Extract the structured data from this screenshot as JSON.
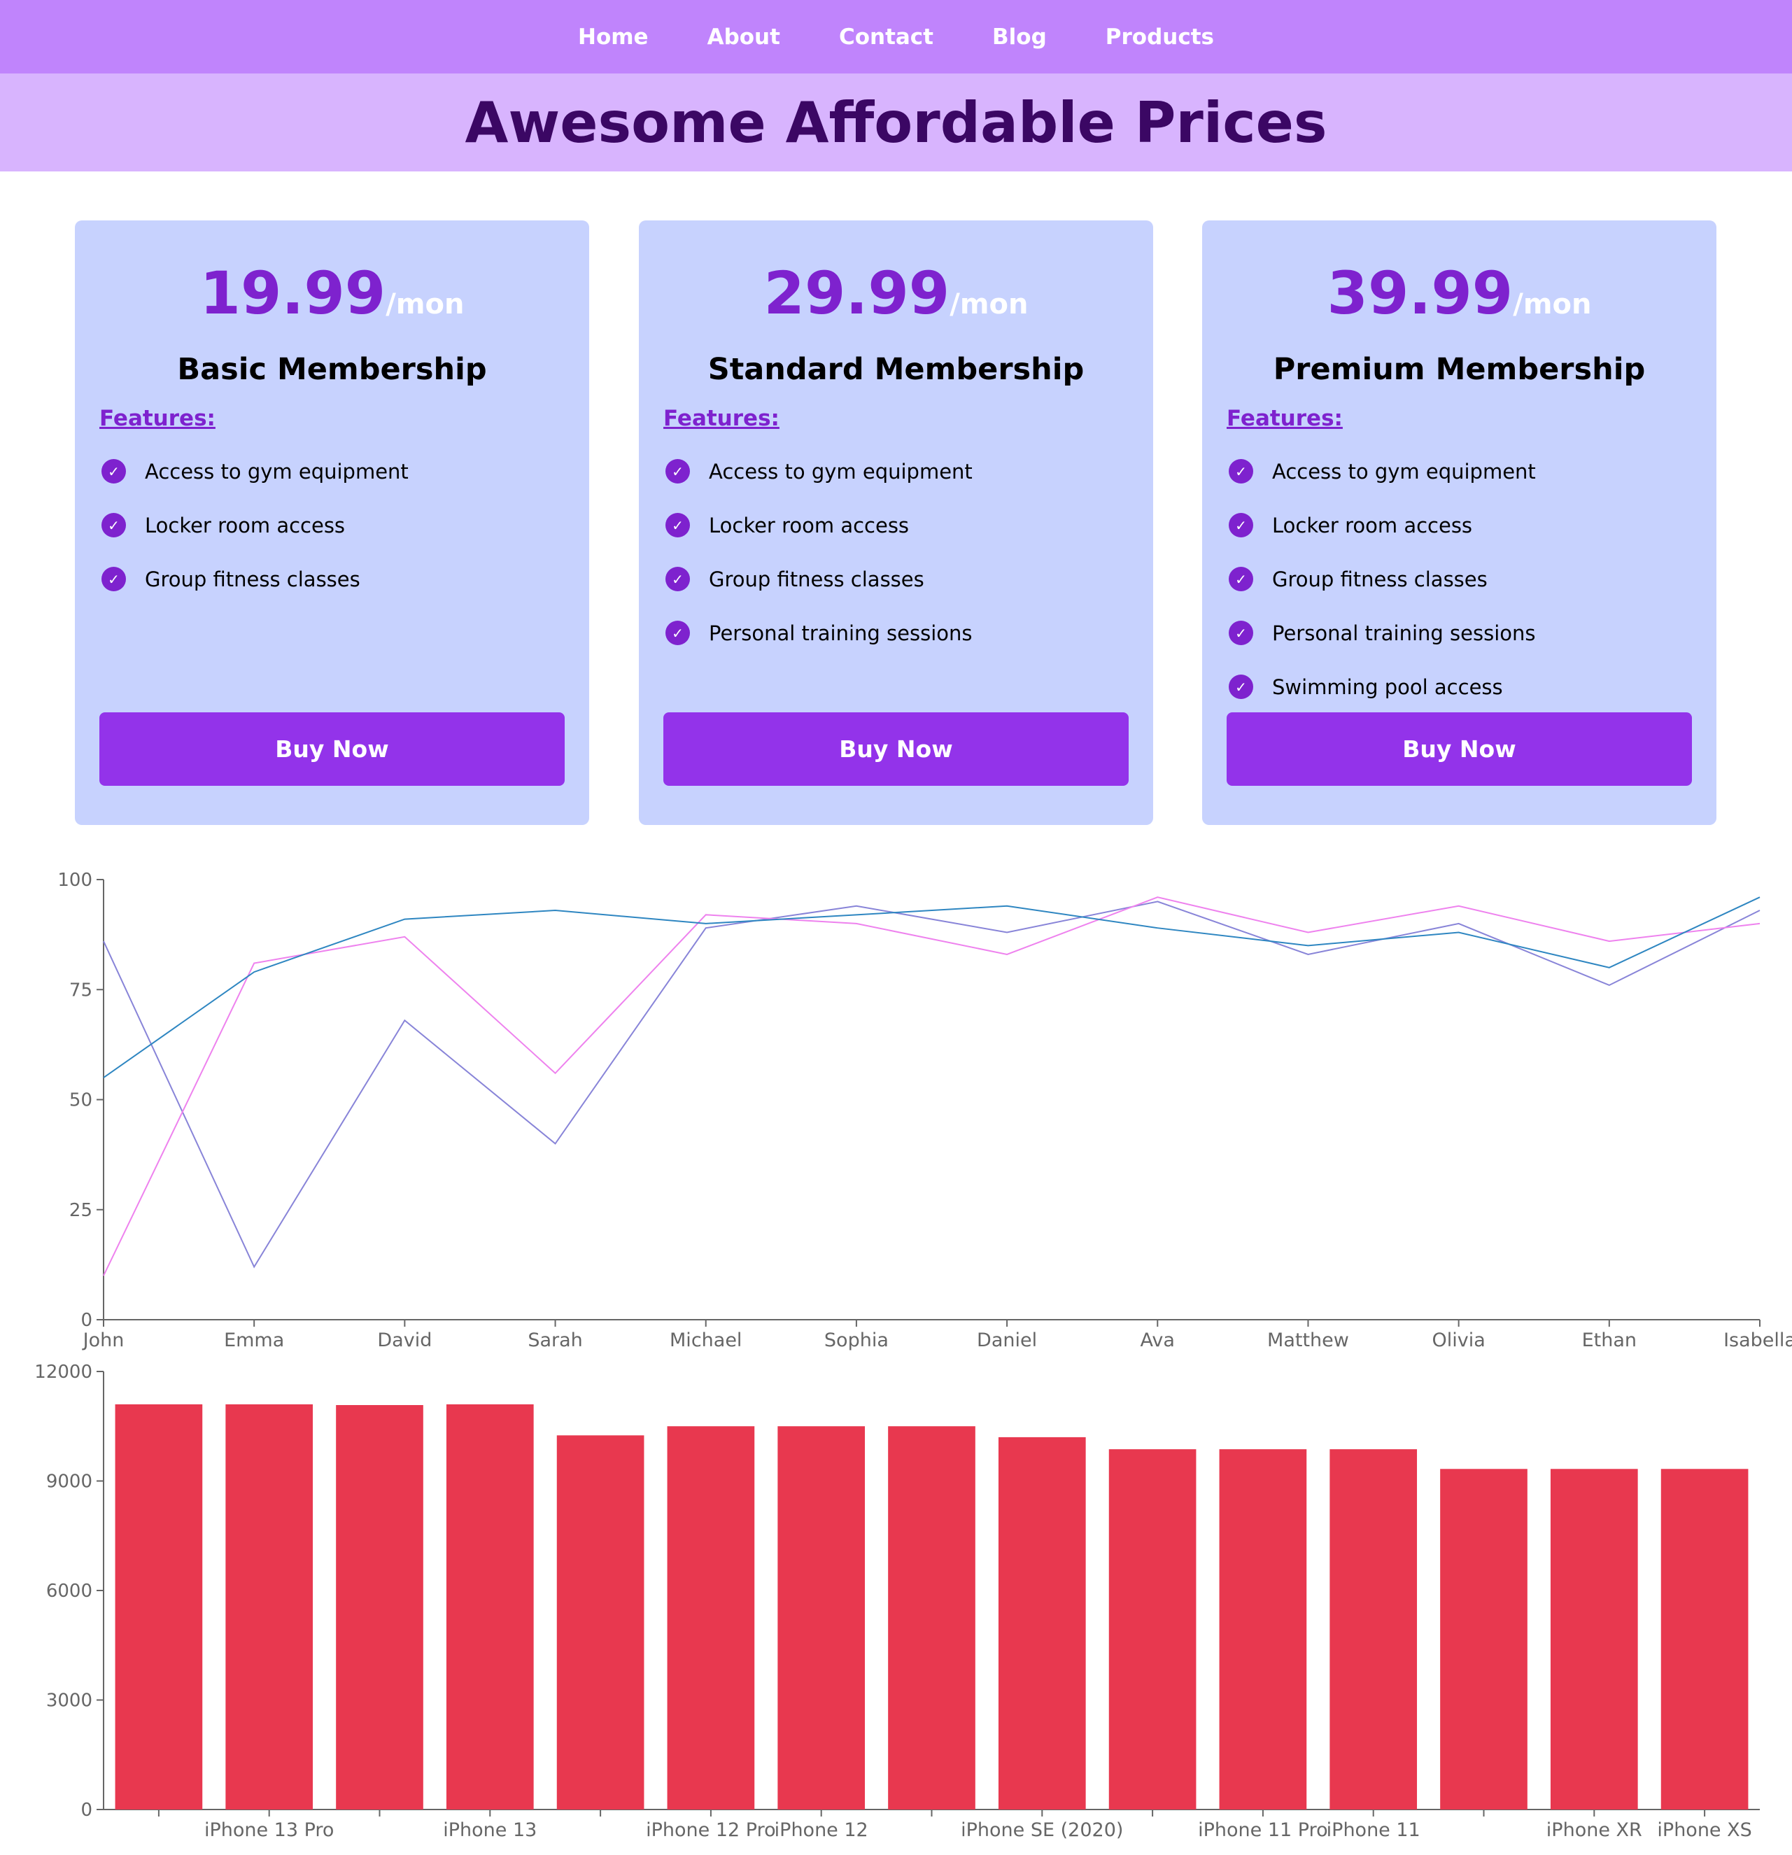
{
  "nav": {
    "items": [
      {
        "label": "Home"
      },
      {
        "label": "About"
      },
      {
        "label": "Contact"
      },
      {
        "label": "Blog"
      },
      {
        "label": "Products"
      }
    ]
  },
  "hero": {
    "title": "Awesome Affordable Prices"
  },
  "plans": [
    {
      "price": "19.99",
      "unit": "/mon",
      "name": "Basic Membership",
      "features_label": "Features:",
      "features": [
        "Access to gym equipment",
        "Locker room access",
        "Group fitness classes"
      ],
      "button": "Buy Now"
    },
    {
      "price": "29.99",
      "unit": "/mon",
      "name": "Standard Membership",
      "features_label": "Features:",
      "features": [
        "Access to gym equipment",
        "Locker room access",
        "Group fitness classes",
        "Personal training sessions"
      ],
      "button": "Buy Now"
    },
    {
      "price": "39.99",
      "unit": "/mon",
      "name": "Premium Membership",
      "features_label": "Features:",
      "features": [
        "Access to gym equipment",
        "Locker room access",
        "Group fitness classes",
        "Personal training sessions",
        "Swimming pool access"
      ],
      "button": "Buy Now"
    }
  ],
  "colors": {
    "nav_bg": "#c084fc",
    "hero_bg": "#d8b4fe",
    "hero_text": "#3b0764",
    "card_bg": "#c7d2fe",
    "accent": "#9333ea",
    "price": "#7e22ce",
    "bar": "#e8384f"
  },
  "chart_data": [
    {
      "type": "line",
      "x": [
        "John",
        "Emma",
        "David",
        "Sarah",
        "Michael",
        "Sophia",
        "Daniel",
        "Ava",
        "Matthew",
        "Olivia",
        "Ethan",
        "Isabella"
      ],
      "series": [
        {
          "color": "#8884d8",
          "values": [
            86,
            12,
            68,
            40,
            89,
            94,
            88,
            95,
            83,
            90,
            76,
            93
          ]
        },
        {
          "color": "#ee82ee",
          "values": [
            10,
            81,
            87,
            56,
            92,
            90,
            83,
            96,
            88,
            94,
            86,
            90
          ]
        },
        {
          "color": "#2e86c1",
          "values": [
            55,
            79,
            91,
            93,
            90,
            92,
            94,
            89,
            85,
            88,
            80,
            96
          ]
        }
      ],
      "yticks": [
        0,
        25,
        50,
        75,
        100
      ],
      "ylim": [
        0,
        100
      ]
    },
    {
      "type": "bar",
      "categories": [
        "",
        "iPhone 13 Pro",
        "",
        "iPhone 13",
        "",
        "iPhone 12 Pro",
        "iPhone 12",
        "",
        "iPhone SE (2020)",
        "",
        "iPhone 11 Pro",
        "iPhone 11",
        "",
        "iPhone XR",
        "iPhone XS"
      ],
      "values": [
        11100,
        11100,
        11080,
        11100,
        10250,
        10500,
        10500,
        10500,
        10200,
        9870,
        9870,
        9870,
        9330,
        9330,
        9330
      ],
      "yticks": [
        0,
        3000,
        6000,
        9000,
        12000
      ],
      "ylim": [
        0,
        12000
      ],
      "color": "#e8384f"
    }
  ]
}
